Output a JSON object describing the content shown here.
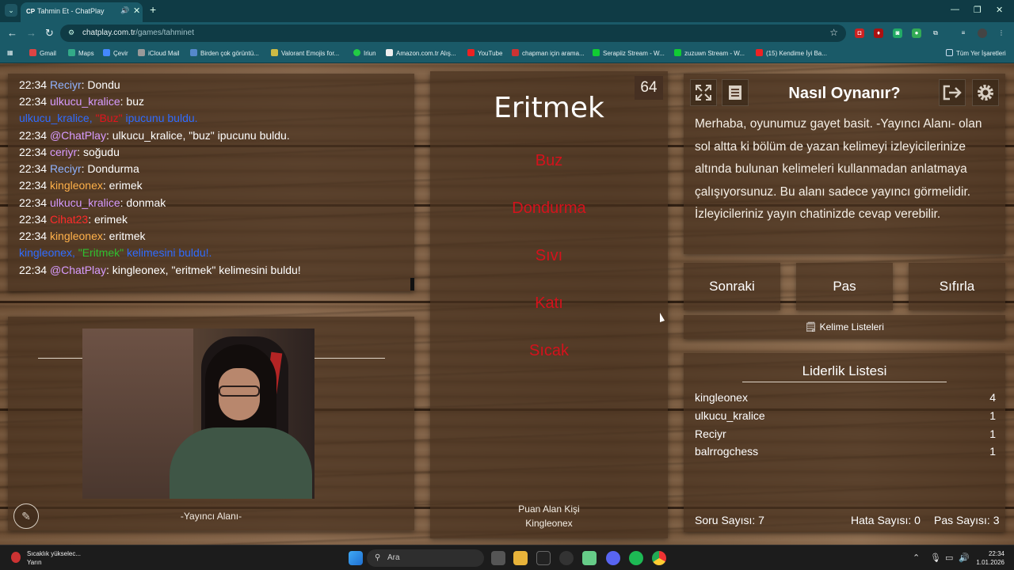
{
  "browser": {
    "tab_title": "Tahmin Et - ChatPlay",
    "tab_favicon": "CP",
    "url_host": "chatplay.com.tr",
    "url_path": "/games/tahminet",
    "bookmarks": [
      "Gmail",
      "Maps",
      "Çevir",
      "iCloud Mail",
      "Birden çok görüntü...",
      "Valorant Emojis for...",
      "Iriun",
      "Amazon.com.tr Alış...",
      "YouTube",
      "chapman için arama...",
      "Serapiiz Stream - W...",
      "zuzuwn Stream - W...",
      "(15) Kendime İyi Ba..."
    ],
    "all_bookmarks": "Tüm Yer İşaretleri"
  },
  "chat": {
    "lines": [
      {
        "time": "22:34",
        "user": "Reciyr",
        "msg": ": Dondu",
        "color": "#8fb2ff"
      },
      {
        "time": "22:34",
        "user": "ulkucu_kralice",
        "msg": ": buz",
        "color": "#d79bff"
      },
      {
        "time": "22:34",
        "user": "@ChatPlay",
        "msg": ": ulkucu_kralice, \"buz\" ipucunu buldu.",
        "color": "#d79bff"
      },
      {
        "time": "22:34",
        "user": "ceriyr",
        "msg": ": soğudu",
        "color": "#d79bff"
      },
      {
        "time": "22:34",
        "user": "Reciyr",
        "msg": ": Dondurma",
        "color": "#8fb2ff"
      },
      {
        "time": "22:34",
        "user": "kingleonex",
        "msg": ": erimek",
        "color": "#ffb14a"
      },
      {
        "time": "22:34",
        "user": "ulkucu_kralice",
        "msg": ": donmak",
        "color": "#d79bff"
      },
      {
        "time": "22:34",
        "user": "Cihat23",
        "msg": ": erimek",
        "color": "#ff2a2a"
      },
      {
        "time": "22:34",
        "user": "kingleonex",
        "msg": ": eritmek",
        "color": "#ffb14a"
      },
      {
        "time": "22:34",
        "user": "@ChatPlay",
        "msg": ": kingleonex, \"eritmek\" kelimesini buldu!",
        "color": "#d79bff"
      }
    ],
    "system_hint": {
      "user": "ulkucu_kralice,",
      "word": "\"Buz\"",
      "text": " ipucunu buldu."
    },
    "system_found": {
      "user": "kingleonex,",
      "word": "\"Eritmek\"",
      "text": " kelimesini buldu!."
    },
    "system_color": "#2f6bff"
  },
  "streamer": {
    "label": "-Yayıncı Alanı-"
  },
  "game": {
    "timer": "64",
    "word": "Eritmek",
    "taboo_words": [
      "Buz",
      "Dondurma",
      "Sıvı",
      "Katı",
      "Sıcak"
    ],
    "scorer_title": "Puan Alan Kişi",
    "scorer_name": "Kingleonex",
    "taboo_color": "#d4121c"
  },
  "howto": {
    "title": "Nasıl Oynanır?",
    "text": "Merhaba, oyunumuz gayet basit. -Yayıncı Alanı- olan sol altta ki bölüm de yazan kelimeyi izleyicilerinize altında bulunan kelimeleri kullanmadan anlatmaya çalışıyorsunuz. Bu alanı sadece yayıncı görmelidir. İzleyicileriniz yayın chatinizde cevap verebilir."
  },
  "actions": {
    "next": "Sonraki",
    "pass": "Pas",
    "reset": "Sıfırla",
    "word_lists": "Kelime Listeleri"
  },
  "leaderboard": {
    "title": "Liderlik Listesi",
    "rows": [
      {
        "name": "kingleonex",
        "score": "4"
      },
      {
        "name": "ulkucu_kralice",
        "score": "1"
      },
      {
        "name": "Reciyr",
        "score": "1"
      },
      {
        "name": "balrrogchess",
        "score": "1"
      }
    ],
    "questions": "Soru Sayısı: 7",
    "errors": "Hata Sayısı: 0",
    "passes": "Pas Sayısı: 3"
  },
  "taskbar": {
    "weather_title": "Sıcaklık yükselec...",
    "weather_sub": "Yarın",
    "search": "Ara",
    "time": "22:34",
    "date": "1.01.2026"
  }
}
